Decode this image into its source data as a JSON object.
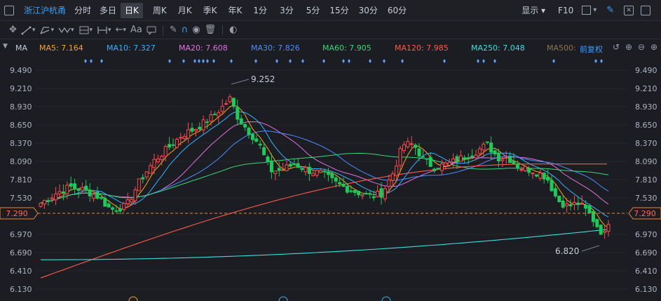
{
  "tabs": {
    "title": "浙江沪杭甬",
    "items": [
      "分时",
      "多日",
      "日K",
      "周K",
      "月K",
      "季K",
      "年K",
      "1分",
      "3分",
      "5分",
      "15分",
      "30分",
      "60分"
    ],
    "active": "日K",
    "display": "显示",
    "f10": "F10"
  },
  "toolbar": {
    "aa": "Aa"
  },
  "ma_bar": {
    "label": "MA",
    "items": [
      {
        "text": "MA5: 7.164",
        "color": "#f5a623"
      },
      {
        "text": "MA10: 7.327",
        "color": "#3ab0ff"
      },
      {
        "text": "MA20: 7.608",
        "color": "#e070e0"
      },
      {
        "text": "MA30: 7.826",
        "color": "#4d8cff"
      },
      {
        "text": "MA60: 7.905",
        "color": "#3cd67a"
      },
      {
        "text": "MA120: 7.985",
        "color": "#ff5a4a"
      },
      {
        "text": "MA250: 7.048",
        "color": "#39e0e0"
      },
      {
        "text": "MA500: ",
        "color": "#8a7650"
      }
    ],
    "adjust": "前复权"
  },
  "chart_data": {
    "type": "candlestick",
    "y_ticks": [
      "9.490",
      "9.210",
      "8.930",
      "8.650",
      "8.370",
      "8.090",
      "7.810",
      "7.530",
      "7.290",
      "6.970",
      "6.690",
      "6.410",
      "6.130"
    ],
    "current_price": "7.290",
    "high_label": "9.252",
    "low_label": "6.820",
    "ylim": [
      6.13,
      9.49
    ],
    "up_color": "#ff4a4a",
    "down_color": "#1fc95a"
  }
}
